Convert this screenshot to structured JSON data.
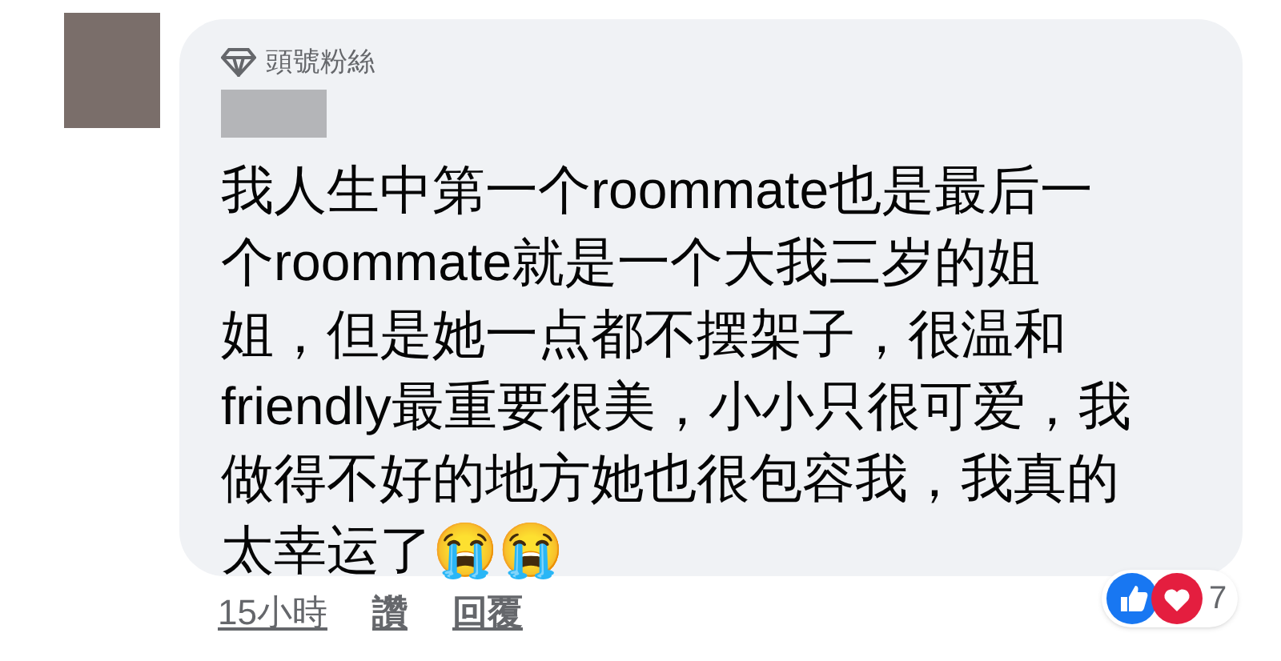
{
  "comment": {
    "badge": "頭號粉絲",
    "text_lines": [
      "我人生中第一个roommate也是最后一",
      "个roommate就是一个大我三岁的姐",
      "姐，但是她一点都不摆架子，很温和",
      "friendly最重要很美，小小只很可爱，我",
      "做得不好的地方她也很包容我，我真的",
      "太幸运了😭😭"
    ],
    "time": "15小時",
    "actions": [
      "讚",
      "回覆"
    ],
    "reaction_count": "7"
  }
}
